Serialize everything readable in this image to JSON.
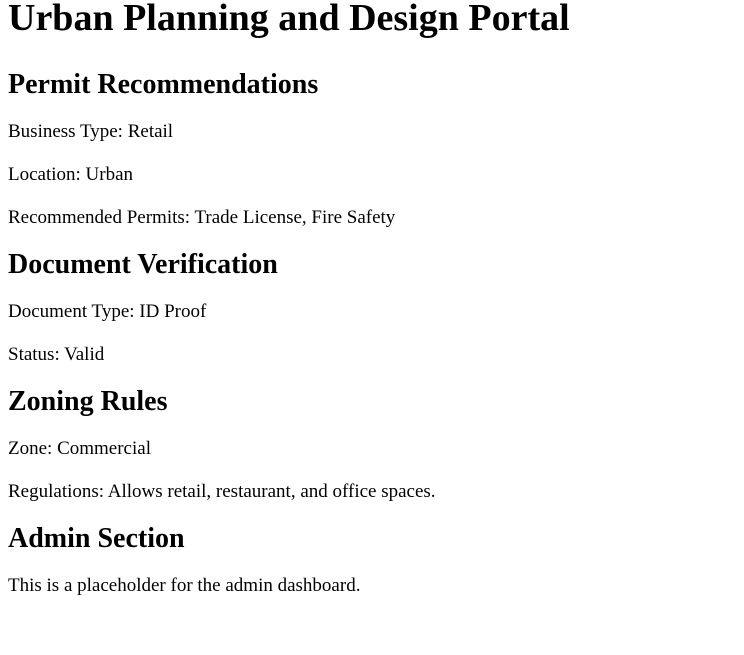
{
  "page": {
    "title": "Urban Planning and Design Portal"
  },
  "permit_recommendations": {
    "heading": "Permit Recommendations",
    "business_type": "Business Type: Retail",
    "location": "Location: Urban",
    "recommended_permits": "Recommended Permits: Trade License, Fire Safety"
  },
  "document_verification": {
    "heading": "Document Verification",
    "document_type": "Document Type: ID Proof",
    "status": "Status: Valid"
  },
  "zoning_rules": {
    "heading": "Zoning Rules",
    "zone": "Zone: Commercial",
    "regulations": "Regulations: Allows retail, restaurant, and office spaces."
  },
  "admin_section": {
    "heading": "Admin Section",
    "description": "This is a placeholder for the admin dashboard."
  }
}
